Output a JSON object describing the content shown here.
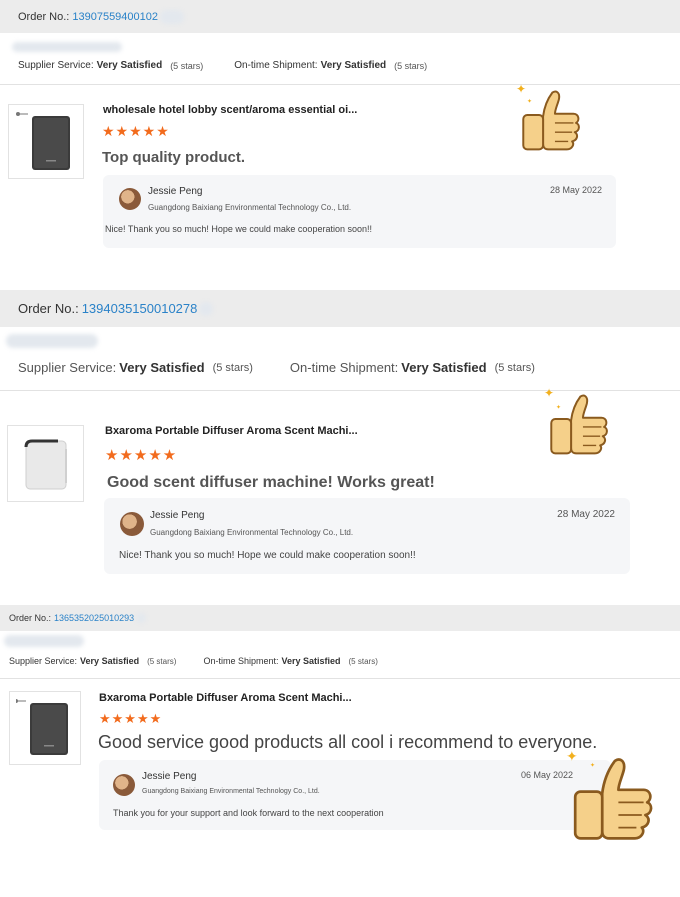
{
  "labels": {
    "order_no": "Order No.:",
    "supplier_service": "Supplier Service:",
    "on_time_shipment": "On-time Shipment:"
  },
  "reviews": [
    {
      "order_number": "13907559400102",
      "supplier_rating": "Very Satisfied",
      "supplier_stars": "(5 stars)",
      "shipment_rating": "Very Satisfied",
      "shipment_stars": "(5 stars)",
      "product_title": "wholesale hotel lobby scent/aroma essential oi...",
      "stars": "★★★★★",
      "review_text": "Top quality product.",
      "reply": {
        "name": "Jessie Peng",
        "company": "Guangdong Baixiang Environmental Technology Co., Ltd.",
        "date": "28 May 2022",
        "message": "Nice! Thank you so much! Hope we could make cooperation soon!!"
      }
    },
    {
      "order_number": "1394035150010278",
      "supplier_rating": "Very Satisfied",
      "supplier_stars": "(5 stars)",
      "shipment_rating": "Very Satisfied",
      "shipment_stars": "(5 stars)",
      "product_title": "Bxaroma Portable Diffuser Aroma Scent Machi...",
      "stars": "★★★★★",
      "review_text": "Good scent diffuser machine! Works great!",
      "reply": {
        "name": "Jessie Peng",
        "company": "Guangdong Baixiang Environmental Technology Co., Ltd.",
        "date": "28 May 2022",
        "message": "Nice! Thank you so much! Hope we could make cooperation soon!!"
      }
    },
    {
      "order_number": "1365352025010293",
      "supplier_rating": "Very Satisfied",
      "supplier_stars": "(5 stars)",
      "shipment_rating": "Very Satisfied",
      "shipment_stars": "(5 stars)",
      "product_title": "Bxaroma Portable Diffuser Aroma Scent Machi...",
      "stars": "★★★★★",
      "review_text": "Good service good products all cool i recommend to everyone.",
      "reply": {
        "name": "Jessie Peng",
        "company": "Guangdong Baixiang Environmental Technology Co., Ltd.",
        "date": "06 May 2022",
        "message": "Thank you for your support and look forward to the next cooperation"
      }
    }
  ],
  "colors": {
    "order_link": "#2a82c8",
    "stars": "#f26b1d",
    "header_bg": "#ececec",
    "reply_bg": "#f5f6f8"
  },
  "icons": {
    "thumbs_up": "thumbs-up-icon",
    "sparkle": "sparkle-icon",
    "avatar": "avatar"
  }
}
